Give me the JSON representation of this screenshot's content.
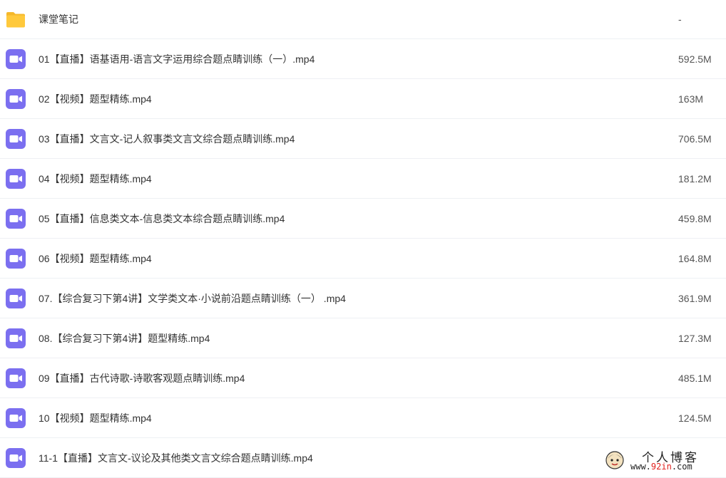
{
  "files": [
    {
      "type": "folder",
      "icon": "folder-icon",
      "name": "课堂笔记",
      "size": "-"
    },
    {
      "type": "video",
      "icon": "video-file-icon",
      "name": "01【直播】语基语用-语言文字运用综合题点睛训练（一）.mp4",
      "size": "592.5M"
    },
    {
      "type": "video",
      "icon": "video-file-icon",
      "name": "02【视频】题型精练.mp4",
      "size": "163M"
    },
    {
      "type": "video",
      "icon": "video-file-icon",
      "name": "03【直播】文言文-记人叙事类文言文综合题点睛训练.mp4",
      "size": "706.5M"
    },
    {
      "type": "video",
      "icon": "video-file-icon",
      "name": "04【视频】题型精练.mp4",
      "size": "181.2M"
    },
    {
      "type": "video",
      "icon": "video-file-icon",
      "name": "05【直播】信息类文本-信息类文本综合题点睛训练.mp4",
      "size": "459.8M"
    },
    {
      "type": "video",
      "icon": "video-file-icon",
      "name": "06【视频】题型精练.mp4",
      "size": "164.8M"
    },
    {
      "type": "video",
      "icon": "video-file-icon",
      "name": "07.【综合复习下第4讲】文学类文本·小说前沿题点睛训练（一）  .mp4",
      "size": "361.9M"
    },
    {
      "type": "video",
      "icon": "video-file-icon",
      "name": "08.【综合复习下第4讲】题型精练.mp4",
      "size": "127.3M"
    },
    {
      "type": "video",
      "icon": "video-file-icon",
      "name": "09【直播】古代诗歌-诗歌客观题点睛训练.mp4",
      "size": "485.1M"
    },
    {
      "type": "video",
      "icon": "video-file-icon",
      "name": "10【视频】题型精练.mp4",
      "size": "124.5M"
    },
    {
      "type": "video",
      "icon": "video-file-icon",
      "name": "11-1【直播】文言文-议论及其他类文言文综合题点睛训练.mp4",
      "size": ""
    }
  ],
  "watermark": {
    "title": "个人博客",
    "url_prefix": "www.",
    "url_accent": "92in",
    "url_suffix": ".com"
  },
  "colors": {
    "folder": "#FFC93C",
    "folder_tab": "#F5B82A",
    "video_icon": "#7B6FF0",
    "row_divider": "#eef0f4"
  }
}
